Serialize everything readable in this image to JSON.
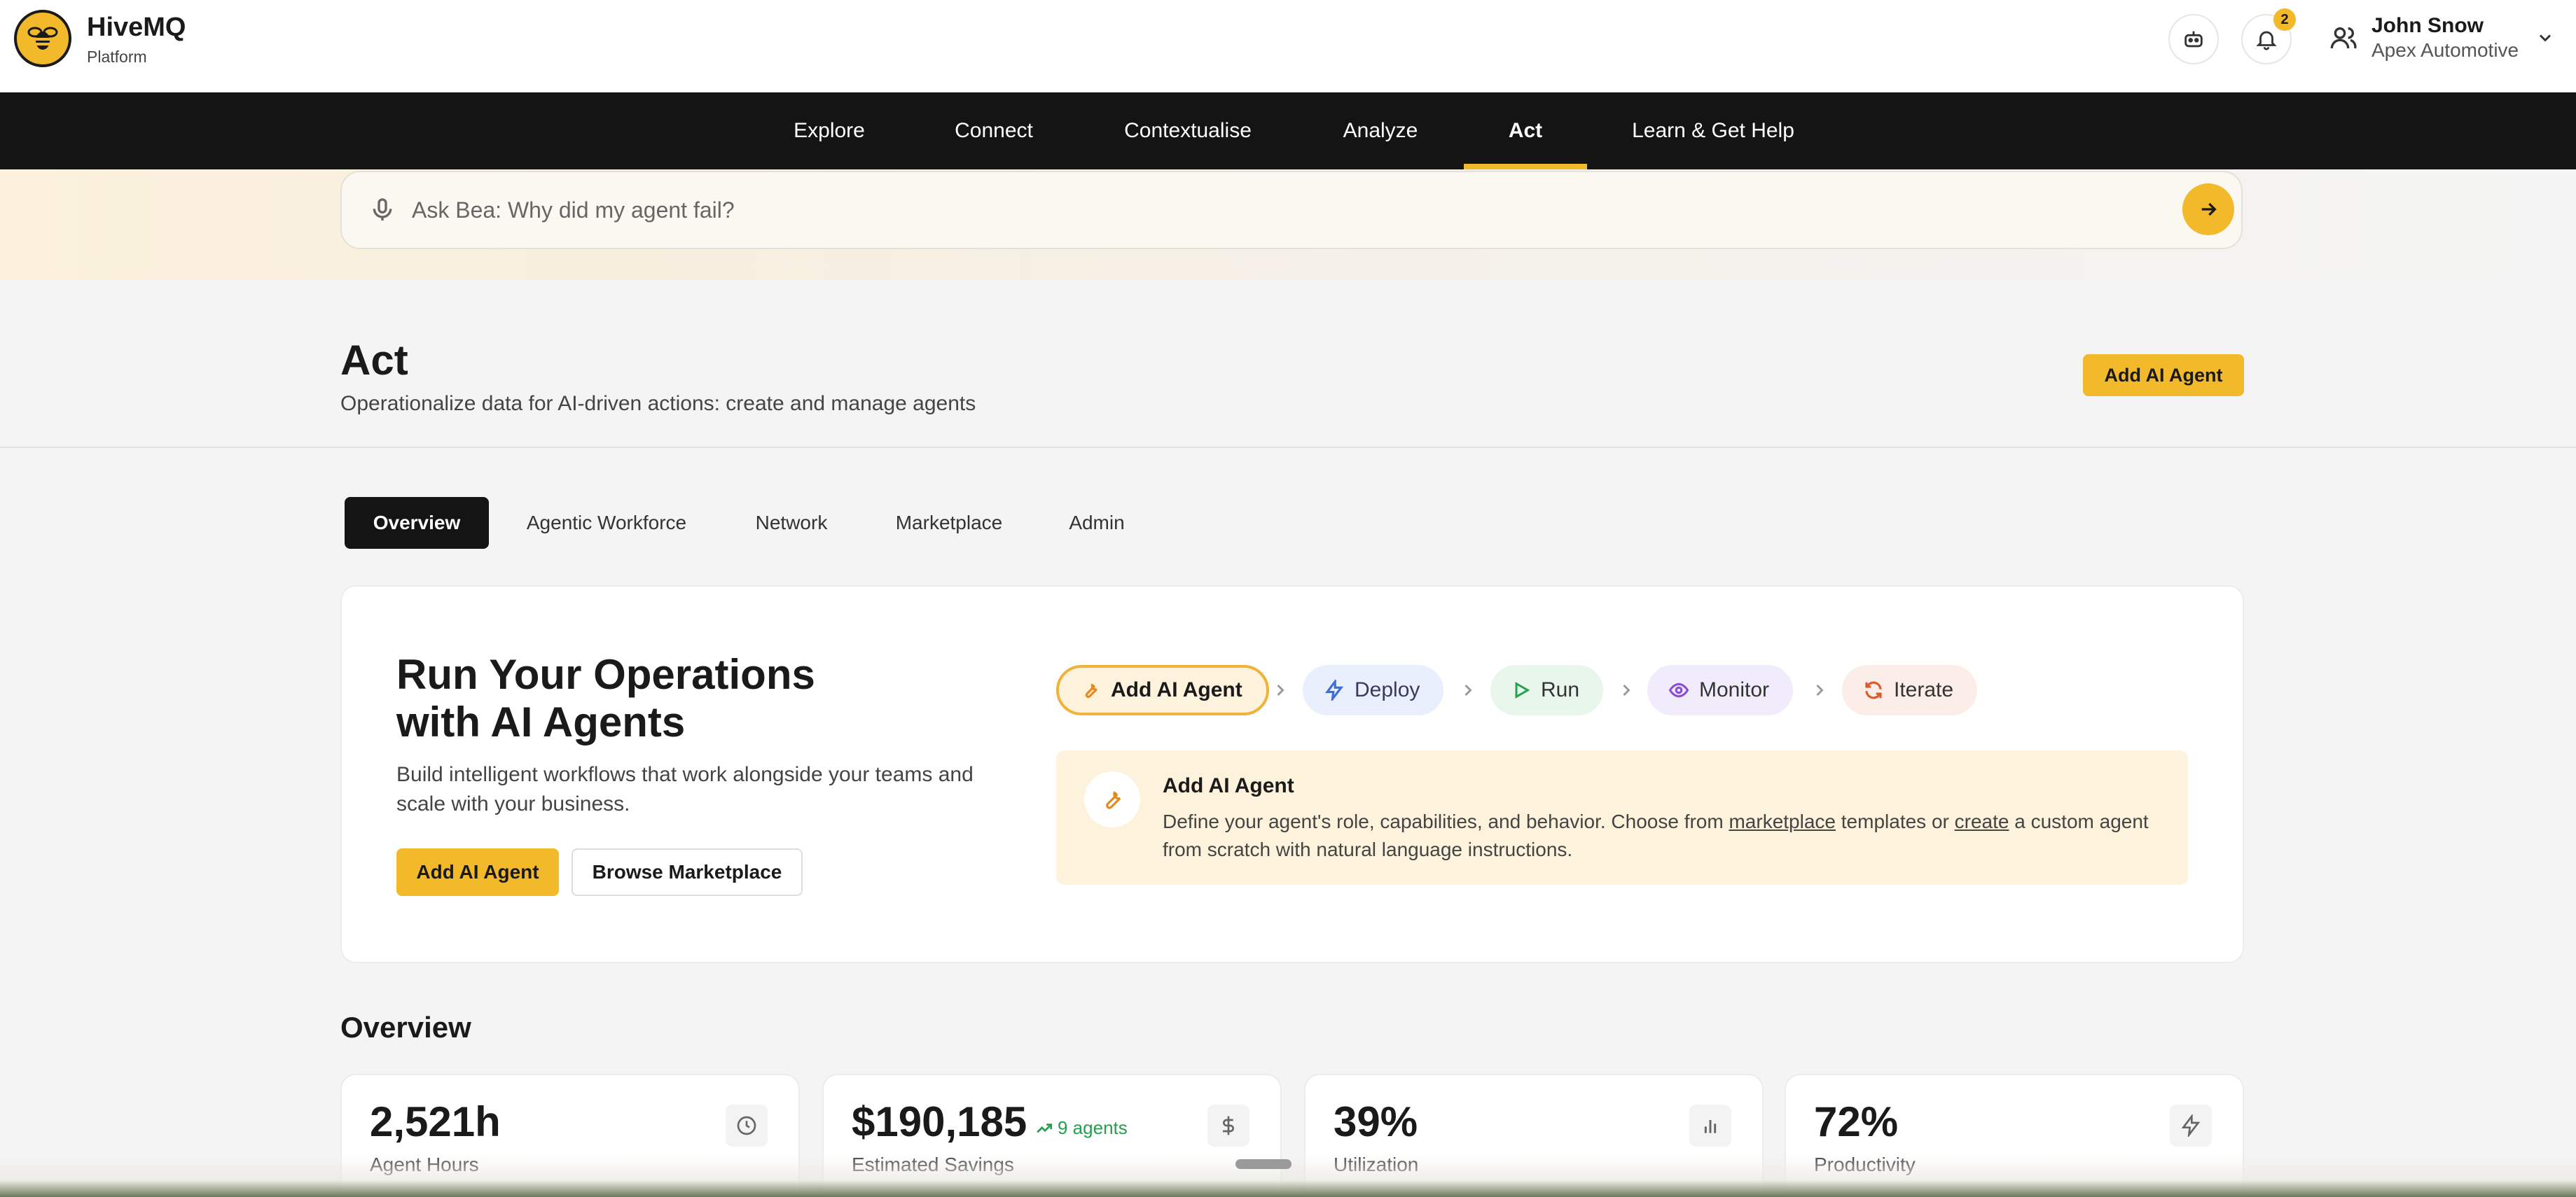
{
  "header": {
    "brand_name": "HiveMQ",
    "brand_sub": "Platform",
    "notification_count": "2",
    "user_name": "John Snow",
    "user_org": "Apex Automotive"
  },
  "nav": {
    "items": [
      {
        "label": "Explore"
      },
      {
        "label": "Connect"
      },
      {
        "label": "Contextualise"
      },
      {
        "label": "Analyze"
      },
      {
        "label": "Act"
      },
      {
        "label": "Learn & Get Help"
      }
    ],
    "active": "Act"
  },
  "ask": {
    "placeholder": "Ask Bea: Why did my agent fail?"
  },
  "page": {
    "title": "Act",
    "subtitle": "Operationalize data for AI-driven actions: create and manage agents",
    "add_agent_label": "Add AI Agent"
  },
  "tabs": {
    "items": [
      {
        "label": "Overview"
      },
      {
        "label": "Agentic Workforce"
      },
      {
        "label": "Network"
      },
      {
        "label": "Marketplace"
      },
      {
        "label": "Admin"
      }
    ],
    "active": "Overview"
  },
  "hero": {
    "title_line1": "Run Your Operations",
    "title_line2": "with AI Agents",
    "description": "Build intelligent workflows that work alongside your teams and scale with your business.",
    "primary_label": "Add AI Agent",
    "secondary_label": "Browse Marketplace",
    "steps": [
      {
        "label": "Add AI Agent",
        "icon": "wrench-icon",
        "color": "#e8891c"
      },
      {
        "label": "Deploy",
        "icon": "bolt-icon",
        "color": "#3b6fd8"
      },
      {
        "label": "Run",
        "icon": "play-icon",
        "color": "#22a04b"
      },
      {
        "label": "Monitor",
        "icon": "eye-icon",
        "color": "#8a4fd8"
      },
      {
        "label": "Iterate",
        "icon": "refresh-icon",
        "color": "#e0572a"
      }
    ],
    "info": {
      "title": "Add AI Agent",
      "text_before": "Define your agent's role, capabilities, and behavior. Choose from ",
      "link1": "marketplace",
      "text_middle": " templates or ",
      "link2": "create",
      "text_after": " a custom agent from scratch with natural language instructions."
    }
  },
  "overview": {
    "heading": "Overview",
    "stats": [
      {
        "value": "2,521h",
        "label": "Agent Hours",
        "icon": "clock-icon"
      },
      {
        "value": "$190,185",
        "label": "Estimated Savings",
        "icon": "dollar-icon",
        "trend": "9 agents"
      },
      {
        "value": "39%",
        "label": "Utilization",
        "icon": "bar-chart-icon"
      },
      {
        "value": "72%",
        "label": "Productivity",
        "icon": "bolt-icon"
      }
    ]
  },
  "colors": {
    "accent": "#f2b92b",
    "nav_bg": "#141414",
    "trend_green": "#22a04b"
  }
}
